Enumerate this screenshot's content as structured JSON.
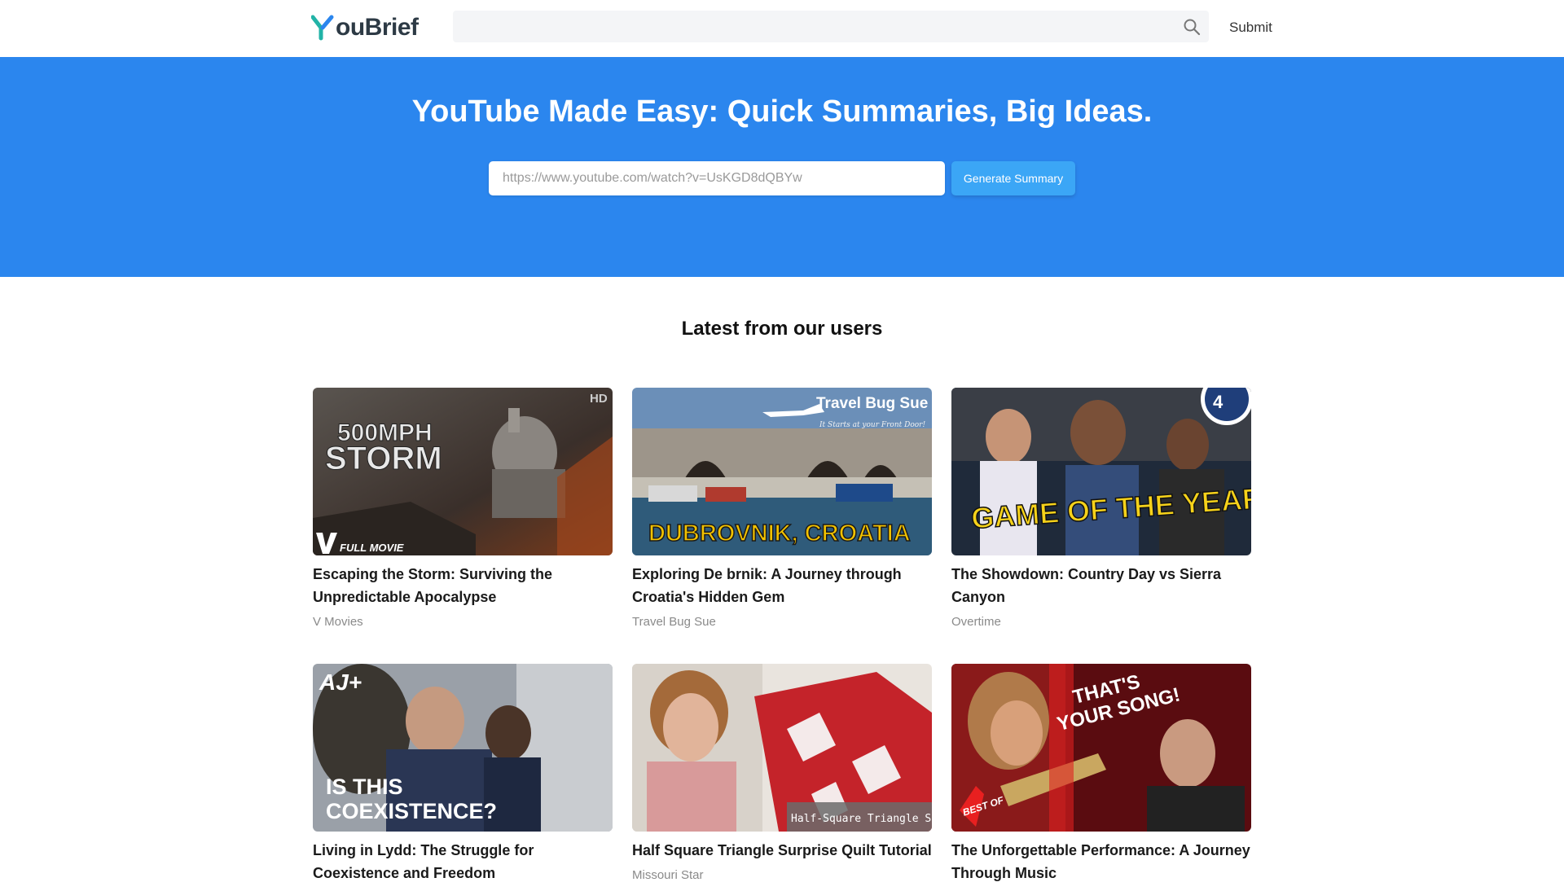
{
  "header": {
    "logo_text": "ouBrief",
    "search_placeholder": "",
    "submit_label": "Submit"
  },
  "hero": {
    "title": "YouTube Made Easy: Quick Summaries, Big Ideas.",
    "url_placeholder": "https://www.youtube.com/watch?v=UsKGD8dQBYw",
    "generate_label": "Generate Summary",
    "background": "#2b86ee",
    "button_color": "#3ba6f6"
  },
  "latest": {
    "title": "Latest from our users",
    "cards": [
      {
        "title": "Escaping the Storm: Surviving the Unpredictable Apocalypse",
        "channel": "V Movies",
        "thumb_lines": [
          "500MPH",
          "STORM"
        ],
        "thumb_badge": "FULL MOVIE",
        "thumb_corner": "HD"
      },
      {
        "title": "Exploring De brnik: A Journey through Croatia's Hidden Gem",
        "channel": "Travel Bug Sue",
        "thumb_lines": [
          "DUBROVNIK, CROATIA"
        ],
        "thumb_badge": "Travel Bug Sue",
        "thumb_corner": "It Starts at your Front Door!"
      },
      {
        "title": "The Showdown: Country Day vs Sierra Canyon",
        "channel": "Overtime",
        "thumb_lines": [
          "GAME OF THE YEAR"
        ],
        "thumb_badge": "4",
        "thumb_corner": ""
      },
      {
        "title": "Living in Lydd: The Struggle for Coexistence and Freedom",
        "channel": "",
        "thumb_lines": [
          "IS THIS",
          "COEXISTENCE?"
        ],
        "thumb_badge": "AJ+",
        "thumb_corner": ""
      },
      {
        "title": "Half Square Triangle Surprise Quilt Tutorial",
        "channel": "Missouri Star",
        "thumb_lines": [
          "Half-Square Triangle Surprise"
        ],
        "thumb_badge": "",
        "thumb_corner": ""
      },
      {
        "title": "The Unforgettable Performance: A Journey Through Music",
        "channel": "",
        "thumb_lines": [
          "THAT'S",
          "YOUR SONG!"
        ],
        "thumb_badge": "BEST OF",
        "thumb_corner": ""
      }
    ]
  }
}
